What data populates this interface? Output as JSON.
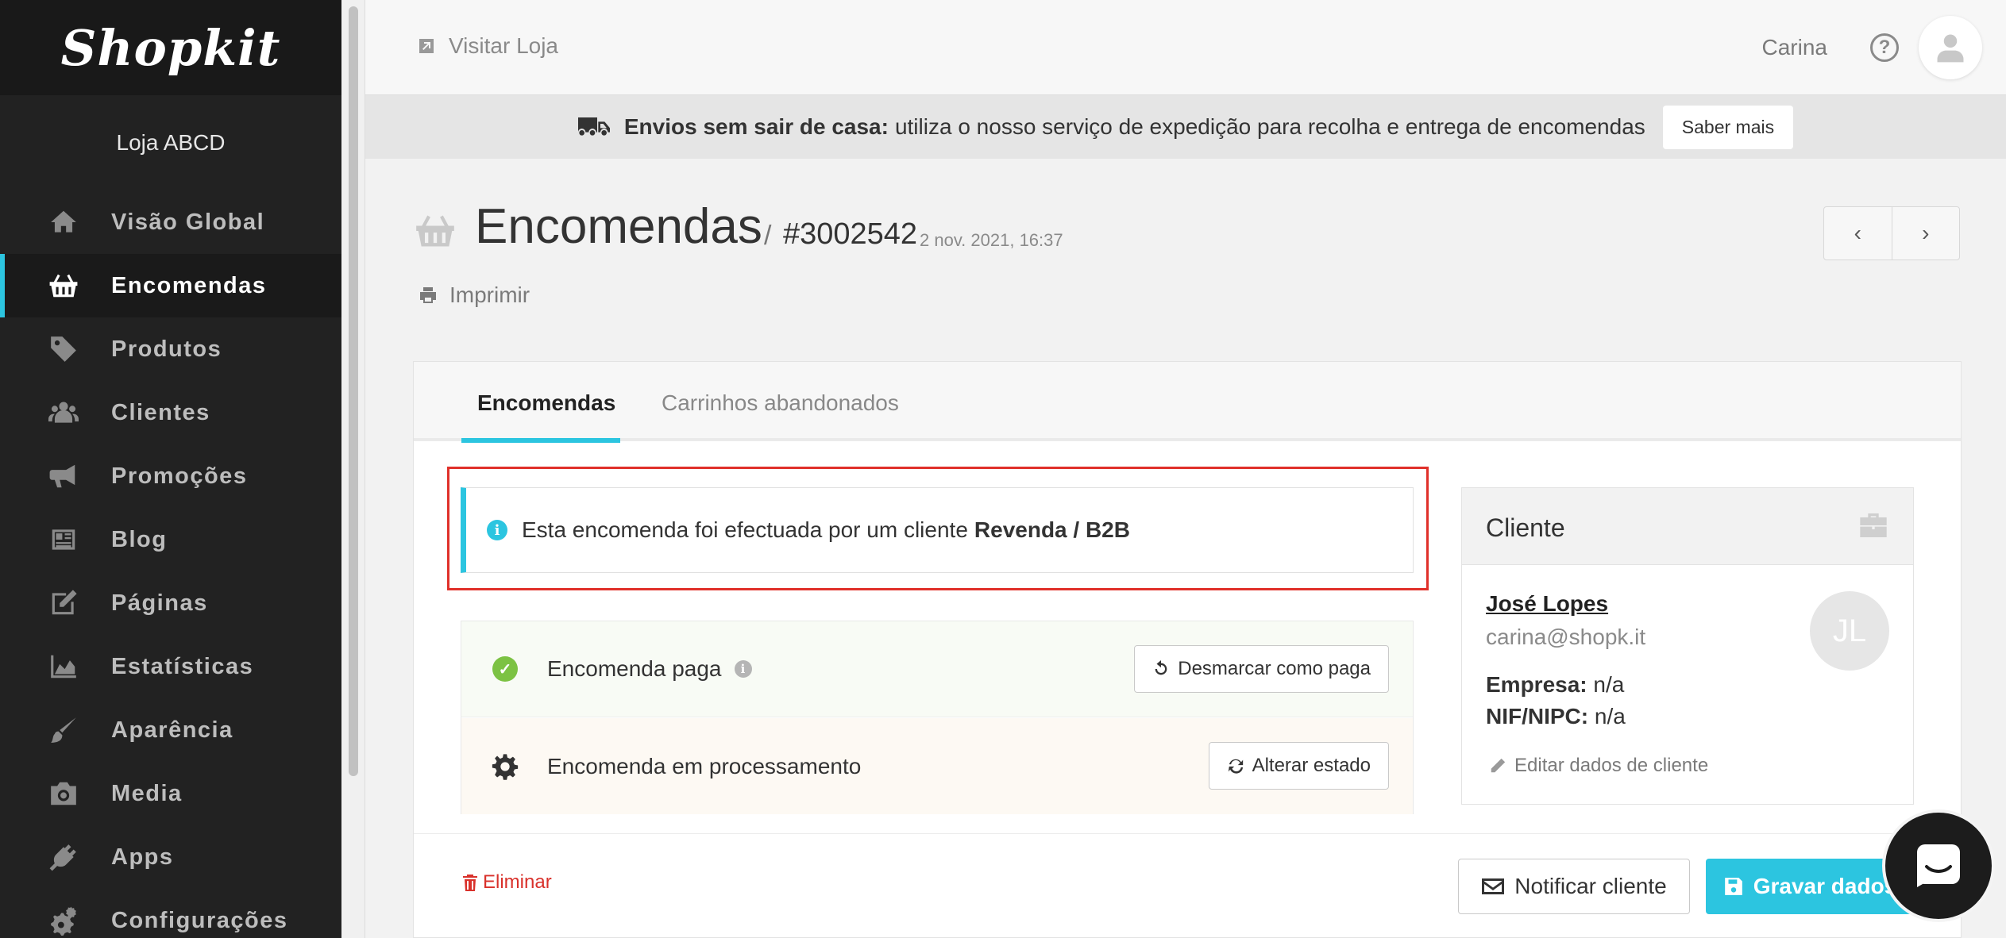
{
  "brand": {
    "logo_text": "Shopkit"
  },
  "sidebar": {
    "store_name": "Loja ABCD",
    "items": [
      {
        "label": "Visão Global",
        "icon": "home-icon",
        "active": false
      },
      {
        "label": "Encomendas",
        "icon": "basket-icon",
        "active": true
      },
      {
        "label": "Produtos",
        "icon": "tag-icon",
        "active": false
      },
      {
        "label": "Clientes",
        "icon": "users-icon",
        "active": false
      },
      {
        "label": "Promoções",
        "icon": "megaphone-icon",
        "active": false
      },
      {
        "label": "Blog",
        "icon": "newspaper-icon",
        "active": false
      },
      {
        "label": "Páginas",
        "icon": "edit-page-icon",
        "active": false
      },
      {
        "label": "Estatísticas",
        "icon": "area-chart-icon",
        "active": false
      },
      {
        "label": "Aparência",
        "icon": "paintbrush-icon",
        "active": false
      },
      {
        "label": "Media",
        "icon": "camera-icon",
        "active": false
      },
      {
        "label": "Apps",
        "icon": "plug-icon",
        "active": false
      },
      {
        "label": "Configurações",
        "icon": "cogs-icon",
        "active": false
      }
    ]
  },
  "topbar": {
    "visit_store": "Visitar Loja",
    "user_name": "Carina",
    "help_glyph": "?"
  },
  "announcement": {
    "bold": "Envios sem sair de casa:",
    "text": "utiliza o nosso serviço de expedição para recolha e entrega de encomendas",
    "button": "Saber mais"
  },
  "page": {
    "title": "Encomendas",
    "separator": "/",
    "order_number": "#3002542",
    "order_date": "2 nov. 2021, 16:37",
    "print_label": "Imprimir",
    "pager_prev": "‹",
    "pager_next": "›"
  },
  "tabs": [
    {
      "label": "Encomendas",
      "active": true
    },
    {
      "label": "Carrinhos abandonados",
      "active": false
    }
  ],
  "alert": {
    "text": "Esta encomenda foi efectuada por um cliente",
    "bold": "Revenda / B2B"
  },
  "status": {
    "paid_label": "Encomenda paga",
    "unmark_button": "Desmarcar como paga",
    "processing_label": "Encomenda em processamento",
    "change_button": "Alterar estado"
  },
  "client": {
    "title": "Cliente",
    "name": "José Lopes",
    "email": "carina@shopk.it",
    "company_label": "Empresa:",
    "company_value": "n/a",
    "nif_label": "NIF/NIPC:",
    "nif_value": "n/a",
    "edit_label": "Editar dados de cliente",
    "initials": "JL"
  },
  "footer": {
    "delete_label": "Eliminar",
    "notify_label": "Notificar cliente",
    "save_label": "Gravar dados"
  },
  "colors": {
    "accent": "#2cc5e0",
    "sidebar_bg": "#222222",
    "danger": "#d9312b",
    "success": "#7cc243"
  }
}
